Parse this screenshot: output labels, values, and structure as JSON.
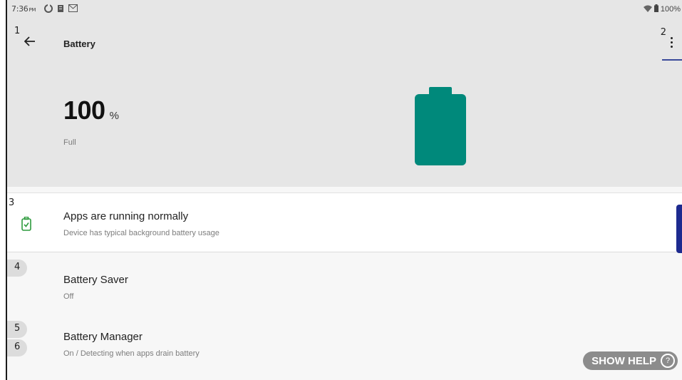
{
  "statusbar": {
    "time": "7:36",
    "ampm": "PM",
    "battery_pct": "100%",
    "notification_icons": [
      "sync-icon",
      "clipboard-icon",
      "gmail-icon"
    ],
    "right_icons": [
      "wifi-icon",
      "battery-icon"
    ]
  },
  "header": {
    "title": "Battery",
    "badge_back": "1",
    "badge_menu": "2"
  },
  "battery": {
    "percent": "100",
    "unit": "%",
    "status": "Full",
    "level": 1.0,
    "color": "#00897b"
  },
  "items": [
    {
      "badge": "3",
      "title": "Apps are running normally",
      "subtitle": "Device has typical background battery usage"
    },
    {
      "badge": "4",
      "title": "Battery Saver",
      "subtitle": "Off"
    },
    {
      "badge": "5",
      "badge2": "6",
      "title": "Battery Manager",
      "subtitle": "On / Detecting when apps drain battery"
    }
  ],
  "help": {
    "label": "SHOW HELP",
    "icon": "?"
  },
  "colors": {
    "accent": "#1d2a8f",
    "ok_green": "#2e9b3e",
    "battery_teal": "#00897b"
  }
}
